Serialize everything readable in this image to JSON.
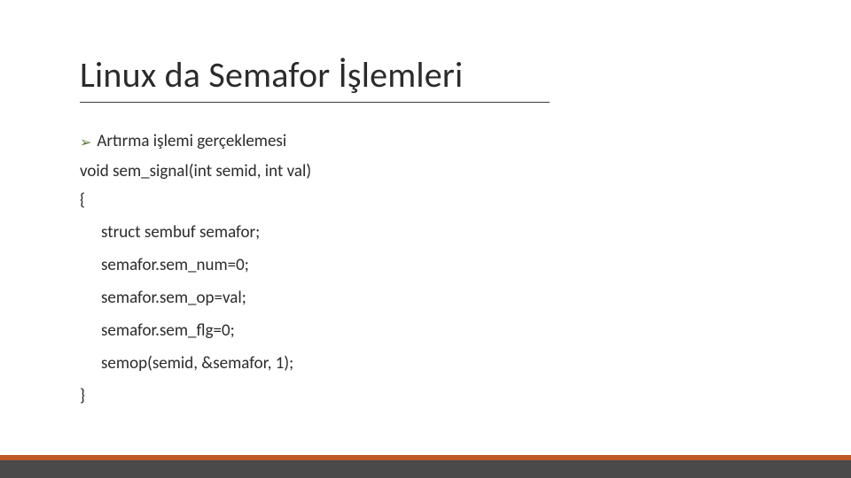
{
  "title": "Linux da Semafor İşlemleri",
  "bullet": {
    "marker_icon": "chevron-right-icon",
    "text": "Artırma işlemi gerçeklemesi"
  },
  "code": {
    "signature": "void sem_signal(int semid, int val)",
    "open_brace": "{",
    "close_brace": "}",
    "lines": [
      "struct sembuf semafor;",
      "semafor.sem_num=0;",
      "semafor.sem_op=val;",
      "semafor.sem_flg=0;",
      "semop(semid, &semafor, 1);"
    ]
  }
}
